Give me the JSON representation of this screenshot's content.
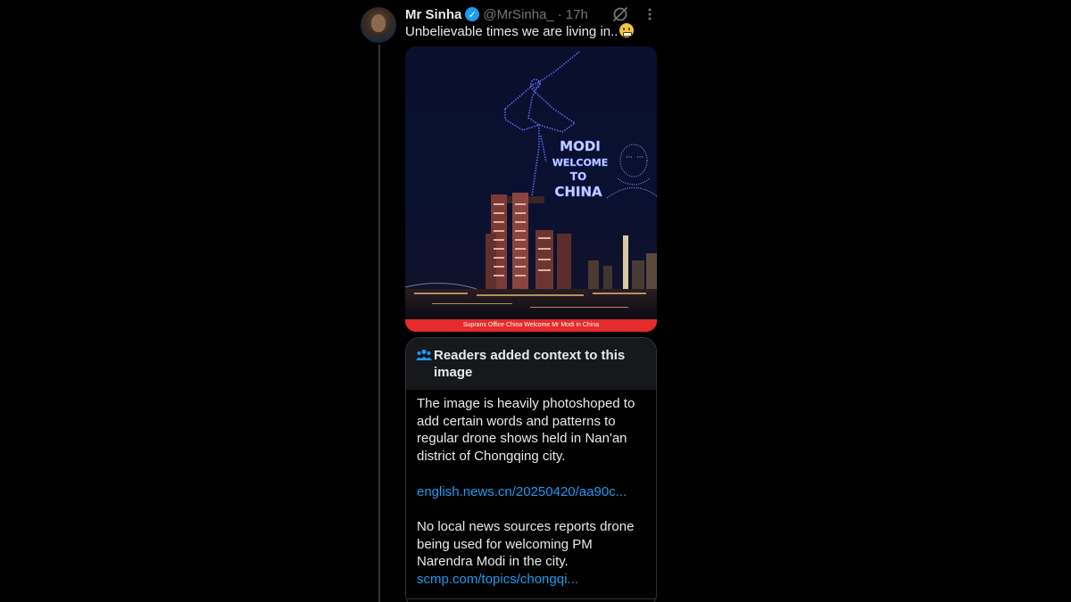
{
  "tweet": {
    "author_name": "Mr Sinha",
    "handle": "@MrSinha_",
    "separator": "·",
    "time": "17h",
    "text": "Unbelievable times we are living in..",
    "emoji": "grimacing-face"
  },
  "media": {
    "drone_text_lines": [
      "MODI",
      "WELCOME",
      "TO",
      "CHINA"
    ],
    "caption": "Suprans Office China Welcome Mr Modi in China",
    "caption_color": "#e52b2b"
  },
  "community_note": {
    "title": "Readers added context to this image",
    "paragraph_1": "The image is heavily photoshoped to add certain words and patterns to regular drone shows held in Nan'an district of  Chongqing city.",
    "link_1": "english.news.cn/20250420/aa90c...",
    "paragraph_2": "No local news sources reports drone being used for welcoming PM Narendra Modi  in the city.",
    "link_2": "scmp.com/topics/chongqi..."
  },
  "colors": {
    "background": "#000000",
    "text": "#e7e9ea",
    "secondary": "#71767b",
    "accent": "#1d9bf0",
    "note_header": "#16181c"
  },
  "icons": [
    "verified-badge-icon",
    "grok-icon",
    "more-options-icon",
    "people-icon"
  ]
}
